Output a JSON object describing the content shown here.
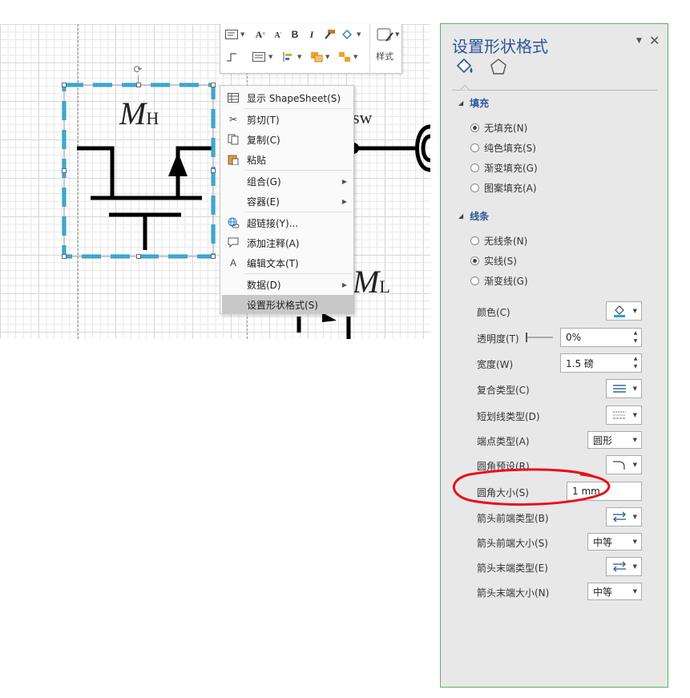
{
  "mini_toolbar": {
    "bold": "B",
    "italic": "I",
    "styles_label": "样式"
  },
  "diagram": {
    "mh_main": "M",
    "mh_sub": "H",
    "ml_main": "M",
    "ml_sub": "L",
    "sw_label": "sw"
  },
  "context_menu": {
    "items": [
      {
        "label": "显示 ShapeSheet(S)",
        "icon": "shapesheet-icon",
        "submenu": false
      },
      {
        "label": "剪切(T)",
        "icon": "scissors-icon",
        "submenu": false
      },
      {
        "label": "复制(C)",
        "icon": "copy-icon",
        "submenu": false
      },
      {
        "label": "粘贴",
        "icon": "paste-icon",
        "submenu": false
      },
      {
        "label": "组合(G)",
        "icon": "",
        "submenu": true
      },
      {
        "label": "容器(E)",
        "icon": "",
        "submenu": true
      },
      {
        "label": "超链接(Y)...",
        "icon": "hyperlink-icon",
        "submenu": false
      },
      {
        "label": "添加注释(A)",
        "icon": "comment-icon",
        "submenu": false
      },
      {
        "label": "编辑文本(T)",
        "icon": "text-icon",
        "submenu": false
      },
      {
        "label": "数据(D)",
        "icon": "",
        "submenu": true
      },
      {
        "label": "设置形状格式(S)",
        "icon": "",
        "submenu": false
      }
    ],
    "highlighted_index": 10
  },
  "format_pane": {
    "title": "设置形状格式",
    "fill_section": {
      "header": "填充",
      "options": [
        "无填充(N)",
        "纯色填充(S)",
        "渐变填充(G)",
        "图案填充(A)"
      ],
      "selected": 0
    },
    "line_section": {
      "header": "线条",
      "options": [
        "无线条(N)",
        "实线(S)",
        "渐变线(G)"
      ],
      "selected": 1
    },
    "properties": {
      "color": {
        "label": "颜色(C)"
      },
      "transparency": {
        "label": "透明度(T)",
        "value": "0%"
      },
      "width": {
        "label": "宽度(W)",
        "value": "1.5 磅"
      },
      "compound_type": {
        "label": "复合类型(C)"
      },
      "dash_type": {
        "label": "短划线类型(D)"
      },
      "cap_type": {
        "label": "端点类型(A)",
        "value": "圆形"
      },
      "round_preset": {
        "label": "圆角预设(R)"
      },
      "round_size": {
        "label": "圆角大小(S)",
        "value": "1 mm"
      },
      "begin_arrow_type": {
        "label": "箭头前端类型(B)"
      },
      "begin_arrow_size": {
        "label": "箭头前端大小(S)",
        "value": "中等"
      },
      "end_arrow_type": {
        "label": "箭头末端类型(E)"
      },
      "end_arrow_size": {
        "label": "箭头末端大小(N)",
        "value": "中等"
      }
    }
  },
  "colors": {
    "accent_blue": "#2b579a",
    "selection_dash": "#1ea6dc",
    "pane_border": "#5fb35b",
    "annotation_red": "#e8101a"
  }
}
